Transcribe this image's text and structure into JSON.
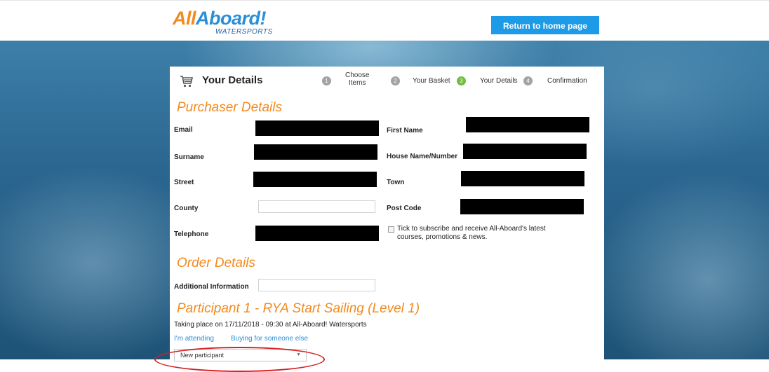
{
  "header": {
    "logo_primary_a": "All",
    "logo_primary_b": "Aboard!",
    "logo_secondary": "WATERSPORTS",
    "home_button": "Return to home page"
  },
  "page": {
    "title": "Your Details",
    "icon": "shopping-cart-icon"
  },
  "steps": [
    {
      "number": "1",
      "label_line1": "Choose",
      "label_line2": "Items"
    },
    {
      "number": "2",
      "label": "Your Basket"
    },
    {
      "number": "3",
      "label": "Your Details",
      "active": true
    },
    {
      "number": "4",
      "label": "Confirmation"
    }
  ],
  "purchaser": {
    "heading": "Purchaser Details",
    "fields": {
      "email": "Email",
      "first_name": "First Name",
      "surname": "Surname",
      "house": "House Name/Number",
      "street": "Street",
      "town": "Town",
      "county": "County",
      "post_code": "Post Code",
      "telephone": "Telephone"
    },
    "subscribe_label": "Tick to subscribe and receive All-Aboard's latest courses, promotions & news."
  },
  "order": {
    "heading": "Order Details",
    "additional_label": "Additional Information"
  },
  "participant": {
    "heading": "Participant 1 - RYA Start Sailing (Level 1)",
    "info": "Taking place on 17/11/2018 - 09:30 at All-Aboard! Watersports",
    "link_attending": "I'm attending",
    "link_someone_else": "Buying for someone else",
    "select_value": "New participant"
  },
  "colors": {
    "accent_orange": "#f28a1e",
    "brand_blue": "#1e9be6",
    "active_step": "#6fbf3a",
    "annotation_red": "#d42020"
  }
}
